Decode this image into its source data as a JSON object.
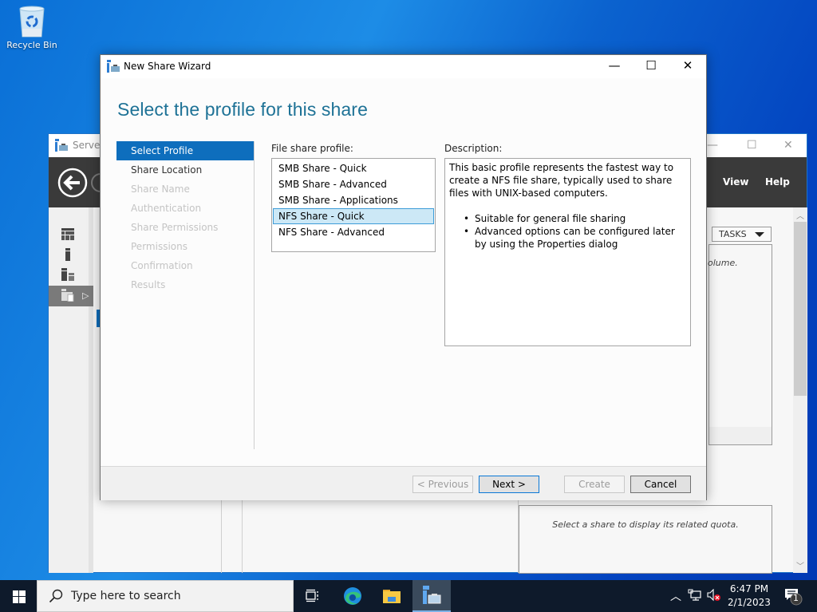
{
  "desktop": {
    "icons": [
      {
        "label": "Recycle Bin",
        "icon": "recycle-bin-icon"
      }
    ]
  },
  "server_manager": {
    "title": "Server",
    "menu": {
      "view": "View",
      "help": "Help"
    },
    "tasks_label": "TASKS",
    "volume_hint": "olume.",
    "quota_hint": "Select a share to display its related quota.",
    "nav_icons": [
      "dashboard-icon",
      "local-server-icon",
      "all-servers-icon",
      "file-storage-icon"
    ]
  },
  "wizard": {
    "title": "New Share Wizard",
    "heading": "Select the profile for this share",
    "steps": [
      {
        "label": "Select Profile",
        "state": "active"
      },
      {
        "label": "Share Location",
        "state": "enabled"
      },
      {
        "label": "Share Name",
        "state": "disabled"
      },
      {
        "label": "Authentication",
        "state": "disabled"
      },
      {
        "label": "Share Permissions",
        "state": "disabled"
      },
      {
        "label": "Permissions",
        "state": "disabled"
      },
      {
        "label": "Confirmation",
        "state": "disabled"
      },
      {
        "label": "Results",
        "state": "disabled"
      }
    ],
    "profile_label": "File share profile:",
    "profiles": [
      "SMB Share - Quick",
      "SMB Share - Advanced",
      "SMB Share - Applications",
      "NFS Share - Quick",
      "NFS Share - Advanced"
    ],
    "selected_profile": "NFS Share - Quick",
    "description_label": "Description:",
    "description_text": "This basic profile represents the fastest way to create a NFS file share, typically used to share files with UNIX-based computers.",
    "description_bullets": [
      "Suitable for general file sharing",
      "Advanced options can be configured later by using the Properties dialog"
    ],
    "buttons": {
      "previous": "< Previous",
      "next": "Next >",
      "create": "Create",
      "cancel": "Cancel"
    }
  },
  "taskbar": {
    "search_placeholder": "Type here to search",
    "time": "6:47 PM",
    "date": "2/1/2023",
    "notification_count": "1"
  },
  "colors": {
    "accent": "#0e6ebd",
    "heading": "#1e7296",
    "selection": "#cce8f6"
  }
}
